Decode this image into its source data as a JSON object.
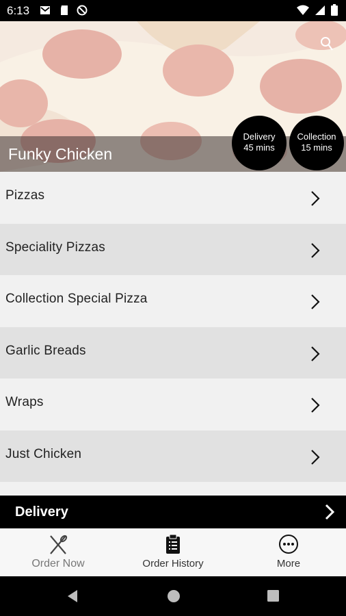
{
  "status_bar": {
    "time": "6:13",
    "left_icons": [
      "gmail-icon",
      "sd-card-icon",
      "do-not-disturb-icon"
    ],
    "right_icons": [
      "wifi-icon",
      "signal-icon",
      "battery-icon"
    ]
  },
  "hero": {
    "restaurant_name": "Funky Chicken",
    "search_icon": "search-icon",
    "delivery_badge": {
      "label": "Delivery",
      "time": "45 mins"
    },
    "collection_badge": {
      "label": "Collection",
      "time": "15 mins"
    }
  },
  "menu": {
    "items": [
      {
        "label": "Pizzas"
      },
      {
        "label": "Speciality Pizzas"
      },
      {
        "label": "Collection Special Pizza"
      },
      {
        "label": "Garlic Breads"
      },
      {
        "label": "Wraps"
      },
      {
        "label": "Just Chicken"
      }
    ]
  },
  "delivery_bar": {
    "label": "Delivery"
  },
  "bottom_nav": {
    "order_now": "Order Now",
    "order_history": "Order History",
    "more": "More"
  },
  "colors": {
    "row_light": "#f1f1f1",
    "row_dark": "#e1e1e1",
    "bar": "#000000"
  }
}
